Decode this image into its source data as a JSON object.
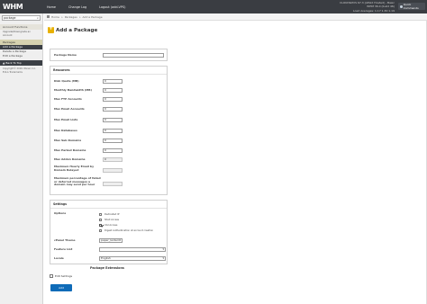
{
  "topbar": {
    "logo": "WHM",
    "nav": [
      "Home",
      "Change Log",
      "Logout (add-VPS)"
    ],
    "info_line1": "CLOUDWAYS 67.3 (AELIX Hosted) - Basic",
    "info_line2": "WHM 36.0 (build 46)",
    "info_line3": "Load Averages: 1.17 1.30 1.19",
    "user_button": "Quick Commands"
  },
  "sidebar": {
    "search_value": "package",
    "search_clear": "×",
    "account_functions": "Account Functions",
    "upgrade_text": "Upgrade/Downgrade an Account",
    "packages_header": "Packages",
    "items": [
      "Add a Package",
      "Delete a Package",
      "Edit a Package"
    ],
    "back_to_top": "Back To Top",
    "footer": "Copyright© 2016 cPanel, Inc. EULA Trademarks"
  },
  "breadcrumb": [
    "Home",
    "»",
    "Packages",
    "»",
    "Add a Package"
  ],
  "page_title": "Add a Package",
  "package_name": {
    "label": "Package Name",
    "value": ""
  },
  "resources": {
    "header": "Resources",
    "rows": [
      {
        "label": "Disk Quota (MB)",
        "value": "0",
        "disabled": false
      },
      {
        "label": "Monthly Bandwidth (MB)",
        "value": "0",
        "disabled": false
      },
      {
        "label": "Max FTP Accounts",
        "value": "0",
        "disabled": false
      },
      {
        "label": "Max Email Accounts",
        "value": "0",
        "disabled": false
      },
      {
        "label": "Max Email Lists",
        "value": "0",
        "disabled": false
      },
      {
        "label": "Max Databases",
        "value": "0",
        "disabled": false
      },
      {
        "label": "Max Sub Domains",
        "value": "0",
        "disabled": false
      },
      {
        "label": "Max Parked Domains",
        "value": "0",
        "disabled": false
      },
      {
        "label": "Max Addon Domains",
        "value": "0",
        "disabled": true
      },
      {
        "label": "Maximum Hourly Email by Domain Relayed",
        "value": "",
        "disabled": true
      },
      {
        "label": "Maximum percentage of failed or deferred messages a domain may send per hour",
        "value": "",
        "disabled": true
      }
    ]
  },
  "settings": {
    "header": "Settings",
    "options_label": "Options",
    "options": [
      {
        "label": "Dedicated IP",
        "checked": false
      },
      {
        "label": "Shell Access",
        "checked": false
      },
      {
        "label": "CGI Access",
        "checked": true
      },
      {
        "label": "Digest Authentication at account creation",
        "checked": false
      }
    ],
    "cpanel_theme": {
      "label": "cPanel Theme",
      "value": "paper_lantern"
    },
    "feature_list": {
      "label": "Feature List",
      "value": ""
    },
    "locale": {
      "label": "Locale",
      "value": "English"
    }
  },
  "extensions": {
    "header": "Package Extensions",
    "cb_label": "Edit Settings"
  },
  "add_button": "Add"
}
